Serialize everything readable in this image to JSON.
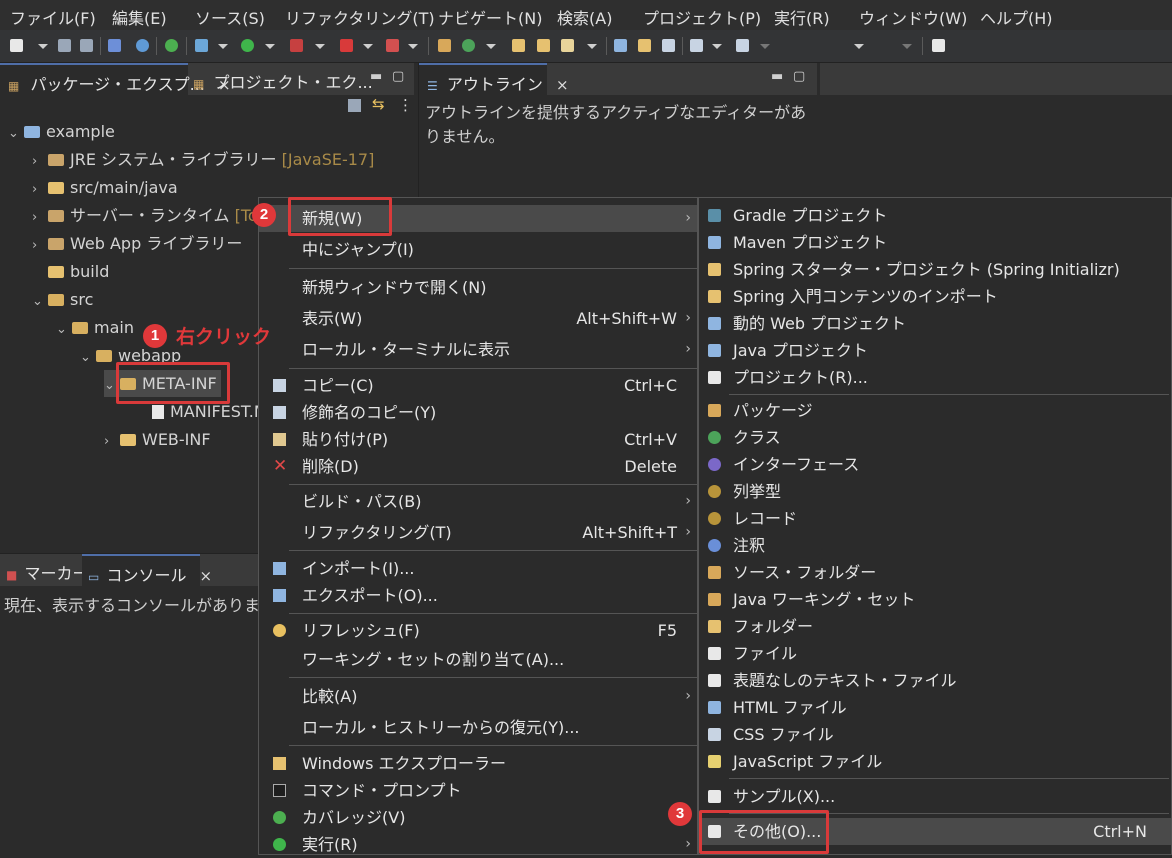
{
  "menubar": [
    "ファイル(F)",
    "編集(E)",
    "ソース(S)",
    "リファクタリング(T)",
    "ナビゲート(N)",
    "検索(A)",
    "プロジェクト(P)",
    "実行(R)",
    "ウィンドウ(W)",
    "ヘルプ(H)"
  ],
  "left_panel": {
    "tabs": [
      {
        "label": "パッケージ・エクスプ..."
      },
      {
        "label": "プロジェクト・エク..."
      }
    ],
    "tree": [
      {
        "label": "example"
      },
      {
        "label": "JRE システム・ライブラリー",
        "decor": "[JavaSE-17]"
      },
      {
        "label": "src/main/java"
      },
      {
        "label": "サーバー・ランタイム",
        "decor": "[Tomcat]"
      },
      {
        "label": "Web App ライブラリー"
      },
      {
        "label": "build"
      },
      {
        "label": "src"
      },
      {
        "label": "main"
      },
      {
        "label": "webapp"
      },
      {
        "label": "META-INF"
      },
      {
        "label": "MANIFEST.MF"
      },
      {
        "label": "WEB-INF"
      }
    ]
  },
  "outline_panel": {
    "tab_label": "アウトライン",
    "message": "アウトラインを提供するアクティブなエディターがありません。"
  },
  "console_panel": {
    "tabs": [
      {
        "label": "マーカー"
      },
      {
        "label": "コンソール"
      }
    ],
    "message": "現在、表示するコンソールがありません。"
  },
  "context_menu": [
    {
      "label": "新規(W)",
      "arrow": true
    },
    {
      "label": "中にジャンプ(I)"
    },
    {
      "label": "新規ウィンドウで開く(N)"
    },
    {
      "label": "表示(W)",
      "accel": "Alt+Shift+W",
      "arrow": true
    },
    {
      "label": "ローカル・ターミナルに表示",
      "arrow": true
    },
    {
      "label": "コピー(C)",
      "accel": "Ctrl+C",
      "icon": "copy-icon"
    },
    {
      "label": "修飾名のコピー(Y)",
      "icon": "copy-qualified-icon"
    },
    {
      "label": "貼り付け(P)",
      "accel": "Ctrl+V",
      "icon": "paste-icon"
    },
    {
      "label": "削除(D)",
      "accel": "Delete",
      "icon": "delete-icon"
    },
    {
      "label": "ビルド・パス(B)",
      "arrow": true
    },
    {
      "label": "リファクタリング(T)",
      "accel": "Alt+Shift+T",
      "arrow": true
    },
    {
      "label": "インポート(I)...",
      "icon": "import-icon"
    },
    {
      "label": "エクスポート(O)...",
      "icon": "export-icon"
    },
    {
      "label": "リフレッシュ(F)",
      "accel": "F5",
      "icon": "refresh-icon"
    },
    {
      "label": "ワーキング・セットの割り当て(A)..."
    },
    {
      "label": "比較(A)",
      "arrow": true
    },
    {
      "label": "ローカル・ヒストリーからの復元(Y)..."
    },
    {
      "label": "Windows エクスプローラー",
      "icon": "explorer-icon"
    },
    {
      "label": "コマンド・プロンプト",
      "icon": "terminal-icon"
    },
    {
      "label": "カバレッジ(V)",
      "icon": "coverage-icon"
    },
    {
      "label": "実行(R)",
      "arrow": true,
      "icon": "run-icon"
    }
  ],
  "submenu": [
    {
      "label": "Gradle プロジェクト",
      "icon": "gradle-icon"
    },
    {
      "label": "Maven プロジェクト",
      "icon": "maven-icon"
    },
    {
      "label": "Spring スターター・プロジェクト (Spring Initializr)",
      "icon": "spring-icon"
    },
    {
      "label": "Spring 入門コンテンツのインポート",
      "icon": "spring-import-icon"
    },
    {
      "label": "動的 Web プロジェクト",
      "icon": "web-project-icon"
    },
    {
      "label": "Java プロジェクト",
      "icon": "java-project-icon"
    },
    {
      "label": "プロジェクト(R)...",
      "icon": "project-icon"
    },
    {
      "label": "パッケージ",
      "icon": "package-icon"
    },
    {
      "label": "クラス",
      "icon": "class-icon"
    },
    {
      "label": "インターフェース",
      "icon": "interface-icon"
    },
    {
      "label": "列挙型",
      "icon": "enum-icon"
    },
    {
      "label": "レコード",
      "icon": "record-icon"
    },
    {
      "label": "注釈",
      "icon": "annotation-icon"
    },
    {
      "label": "ソース・フォルダー",
      "icon": "source-folder-icon"
    },
    {
      "label": "Java ワーキング・セット",
      "icon": "working-set-icon"
    },
    {
      "label": "フォルダー",
      "icon": "folder-icon"
    },
    {
      "label": "ファイル",
      "icon": "file-icon"
    },
    {
      "label": "表題なしのテキスト・ファイル",
      "icon": "text-file-icon"
    },
    {
      "label": "HTML ファイル",
      "icon": "html-file-icon"
    },
    {
      "label": "CSS ファイル",
      "icon": "css-file-icon"
    },
    {
      "label": "JavaScript ファイル",
      "icon": "js-file-icon"
    },
    {
      "label": "サンプル(X)...",
      "icon": "sample-icon"
    },
    {
      "label": "その他(O)...",
      "accel": "Ctrl+N",
      "icon": "other-icon"
    }
  ],
  "annotations": {
    "step1_number": "1",
    "step1_text": "右クリック",
    "step2_number": "2",
    "step3_number": "3"
  },
  "colors": {
    "highlight": "#d93a3a",
    "badge": "#e0383a",
    "selected_bg": "#4a4a4a"
  }
}
